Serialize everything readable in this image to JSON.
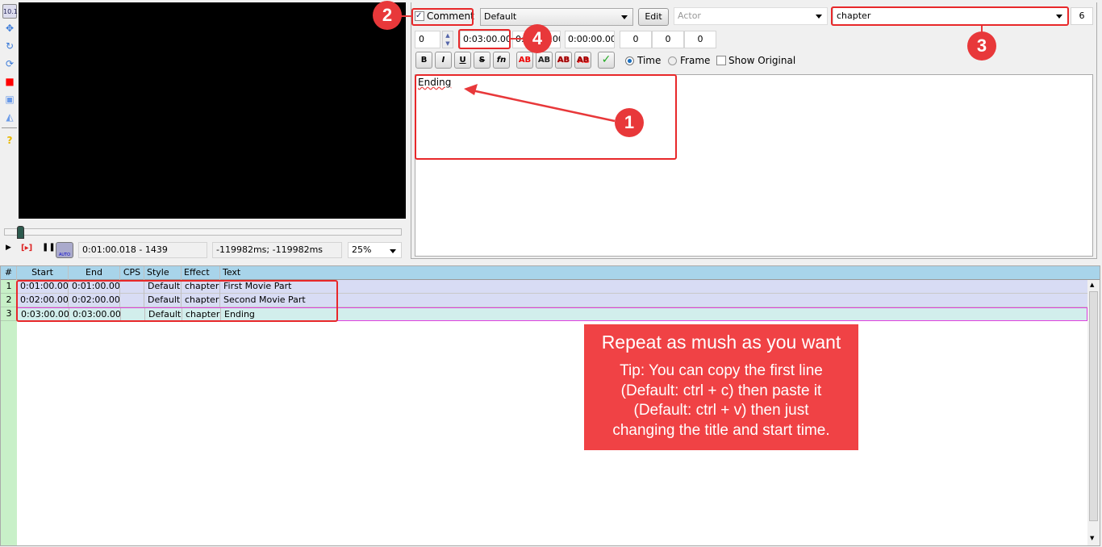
{
  "toolbar": {
    "icons": [
      "standard-tool-icon",
      "drag-icon",
      "rotate-z-icon",
      "rotate-xy-icon",
      "scale-icon",
      "clip-icon",
      "vector-clip-icon",
      "help-icon"
    ]
  },
  "video": {
    "time_display": "0:01:00.018 - 1439",
    "offset_display": "-119982ms; -119982ms",
    "zoom": "25%",
    "seek_position": 0.01,
    "auto_label": "AUTO"
  },
  "editor": {
    "comment_label": "Comment",
    "comment_checked": true,
    "style": "Default",
    "edit_label": "Edit",
    "actor_placeholder": "Actor",
    "effect": "chapter",
    "char_count": "6",
    "layer": "0",
    "start_time": "0:03:00.00",
    "end_time": "0:03:00.00",
    "duration": "0:00:00.00",
    "margin_l": "0",
    "margin_r": "0",
    "margin_v": "0",
    "format_buttons": [
      "B",
      "I",
      "U",
      "S",
      "fn"
    ],
    "color_buttons": [
      "AB",
      "AB",
      "AB",
      "AB"
    ],
    "time_label": "Time",
    "frame_label": "Frame",
    "show_original_label": "Show Original",
    "text": "Ending"
  },
  "grid": {
    "columns": [
      "#",
      "Start",
      "End",
      "CPS",
      "Style",
      "Effect",
      "Text"
    ],
    "rows": [
      {
        "n": "1",
        "start": "0:01:00.00",
        "end": "0:01:00.00",
        "cps": "",
        "style": "Default",
        "effect": "chapter",
        "text": "First Movie Part"
      },
      {
        "n": "2",
        "start": "0:02:00.00",
        "end": "0:02:00.00",
        "cps": "",
        "style": "Default",
        "effect": "chapter",
        "text": "Second Movie Part"
      },
      {
        "n": "3",
        "start": "0:03:00.00",
        "end": "0:03:00.00",
        "cps": "",
        "style": "Default",
        "effect": "chapter",
        "text": "Ending"
      }
    ]
  },
  "annotations": {
    "badges": [
      "1",
      "2",
      "3",
      "4"
    ],
    "callout_title": "Repeat as mush as you want",
    "callout_lines": [
      "Tip: You can copy the first line",
      "(Default: ctrl + c) then paste it",
      "(Default: ctrl + v) then just",
      "changing the title and start time."
    ],
    "color": "#e8383a"
  }
}
